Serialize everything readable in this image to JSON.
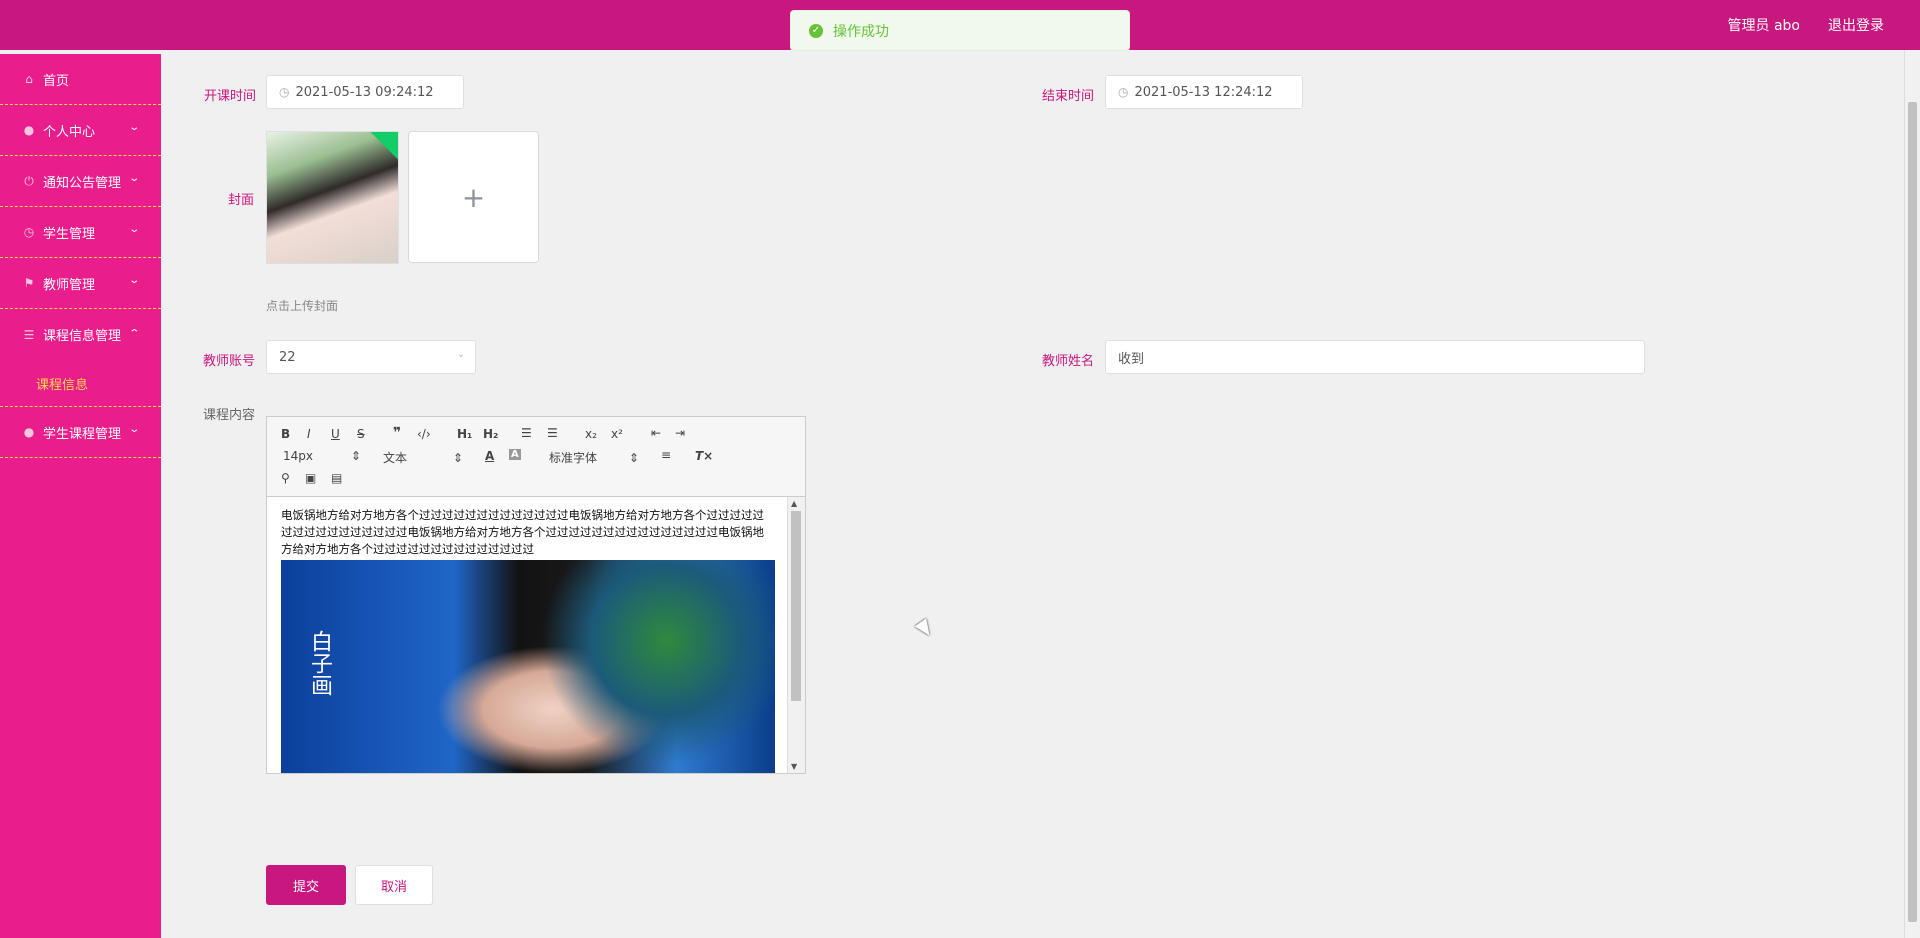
{
  "header": {
    "user_label": "管理员 abo",
    "logout_label": "退出登录",
    "toast_message": "操作成功",
    "brand_color": "#c8177e"
  },
  "sidebar": {
    "items": [
      {
        "label": "首页",
        "icon": "home-icon"
      },
      {
        "label": "个人中心",
        "icon": "user-icon"
      },
      {
        "label": "通知公告管理",
        "icon": "power-icon"
      },
      {
        "label": "学生管理",
        "icon": "gauge-icon"
      },
      {
        "label": "教师管理",
        "icon": "flag-icon"
      },
      {
        "label": "课程信息管理",
        "icon": "menu-icon"
      },
      {
        "label": "学生课程管理",
        "icon": "user-icon"
      }
    ],
    "active_submenu": "课程信息"
  },
  "form": {
    "start_time_label": "开课时间",
    "start_time_value": "2021-05-13 09:24:12",
    "end_time_label": "结束时间",
    "end_time_value": "2021-05-13 12:24:12",
    "cover_label": "封面",
    "cover_hint": "点击上传封面",
    "teacher_account_label": "教师账号",
    "teacher_account_value": "22",
    "teacher_name_label": "教师姓名",
    "teacher_name_value": "收到",
    "content_label": "课程内容",
    "submit_label": "提交",
    "cancel_label": "取消"
  },
  "editor": {
    "font_size": "14px",
    "block_format": "文本",
    "font_family": "标准字体",
    "content_text": "电饭锅地方给对方地方各个过过过过过过过过过过过过过电饭锅地方给对方地方各个过过过过过过过过过过过过过过过过电饭锅地方给对方地方各个过过过过过过过过过过过过过过过电饭锅地方给对方地方各个过过过过过过过过过过过过过过"
  }
}
